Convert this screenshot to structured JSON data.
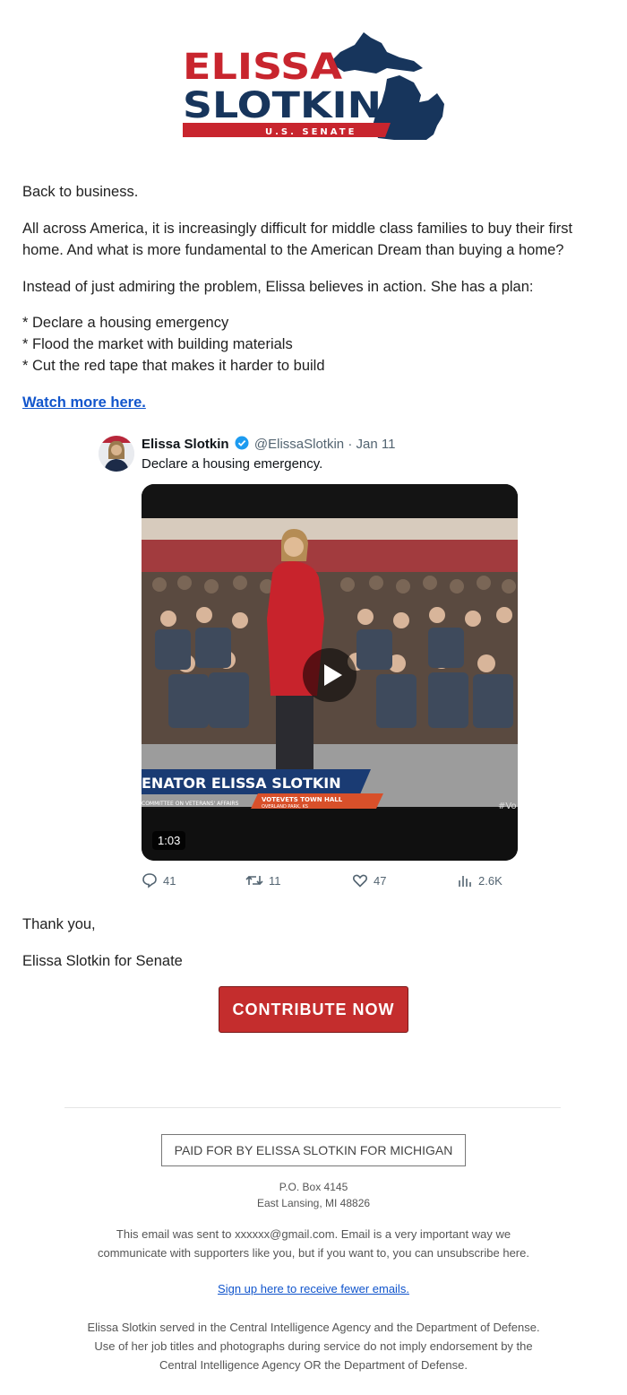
{
  "logo": {
    "line1": "ELISSA",
    "line2": "SLOTKIN",
    "tagline": "U.S. SENATE",
    "colors": {
      "red": "#c8252e",
      "navy": "#17355c"
    }
  },
  "body": {
    "greeting": "Back to business.",
    "para1": "All across America, it is increasingly difficult for middle class families to buy their first home. And what is more fundamental to the American Dream than buying a home?",
    "para2": "Instead of just admiring the problem, Elissa believes in action. She has a plan:",
    "plan": [
      "* Declare a housing emergency",
      "* Flood the market with building materials",
      "* Cut the red tape that makes it harder to build"
    ],
    "watch_link": "Watch more here."
  },
  "tweet": {
    "name": "Elissa Slotkin",
    "verified_icon": "verified-badge-icon",
    "handle": "@ElissaSlotkin",
    "separator": "·",
    "date": "Jan 11",
    "text": "Declare a housing emergency.",
    "video": {
      "banner_name": "ENATOR ELISSA SLOTKIN",
      "banner_sub": "COMMITTEE ON VETERANS' AFFAIRS",
      "event": "VOTEVETS TOWN HALL",
      "event_location": "OVERLAND PARK, KS",
      "hashtag": "#Vo",
      "duration": "1:03"
    },
    "stats": {
      "replies": "41",
      "retweets": "11",
      "likes": "47",
      "views": "2.6K"
    }
  },
  "closing": {
    "thanks": "Thank you,",
    "signature": "Elissa Slotkin for Senate",
    "contribute_label": "CONTRIBUTE NOW",
    "button_color": "#c42d2d"
  },
  "footer": {
    "paid_for": "PAID FOR BY ELISSA SLOTKIN FOR MICHIGAN",
    "address_line1": "P.O. Box 4145",
    "address_line2": "East Lansing, MI 48826",
    "sent_line1": "This email was sent to xxxxxx@gmail.com. Email is a very important way we",
    "sent_line2": "communicate with supporters like you, but if you want to, you can unsubscribe here.",
    "fewer_emails_link": "Sign up here to receive fewer emails.",
    "disclaimer1": "Elissa Slotkin served in the Central Intelligence Agency and the Department of Defense.",
    "disclaimer2": "Use of her job titles and photographs during service do not imply endorsement by the",
    "disclaimer3": "Central Intelligence Agency OR the Department of Defense."
  }
}
